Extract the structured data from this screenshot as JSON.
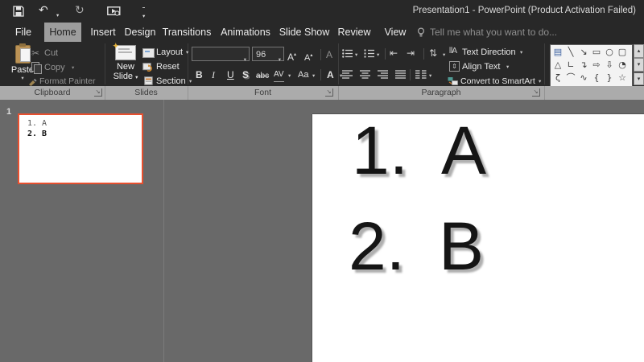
{
  "titlebar": {
    "title": "Presentation1 - PowerPoint (Product Activation Failed)"
  },
  "tabs": [
    {
      "label": "File"
    },
    {
      "label": "Home"
    },
    {
      "label": "Insert"
    },
    {
      "label": "Design"
    },
    {
      "label": "Transitions"
    },
    {
      "label": "Animations"
    },
    {
      "label": "Slide Show"
    },
    {
      "label": "Review"
    },
    {
      "label": "View"
    }
  ],
  "active_tab": "Home",
  "tellme": {
    "text": "Tell me what you want to do..."
  },
  "ribbon": {
    "clipboard": {
      "group_label": "Clipboard",
      "paste": "Paste",
      "cut": "Cut",
      "copy": "Copy",
      "format_painter": "Format Painter"
    },
    "slides": {
      "group_label": "Slides",
      "new_slide_line1": "New",
      "new_slide_line2": "Slide",
      "layout": "Layout",
      "reset": "Reset",
      "section": "Section"
    },
    "font": {
      "group_label": "Font",
      "font_name_value": "",
      "font_size_value": "96",
      "grow_font": "A",
      "shrink_font": "A",
      "clear_formatting": "A",
      "bold": "B",
      "italic": "I",
      "underline": "U",
      "text_shadow": "S",
      "strikethrough": "abc",
      "character_spacing": "AV",
      "change_case": "Aa",
      "font_color": "A"
    },
    "paragraph": {
      "group_label": "Paragraph",
      "text_direction": "Text Direction",
      "align_text": "Align Text",
      "convert_smartart": "Convert to SmartArt"
    },
    "drawing": {
      "shapes": [
        {
          "name": "text-box",
          "glyph": "▤"
        },
        {
          "name": "line",
          "glyph": "╲"
        },
        {
          "name": "line-arrow",
          "glyph": "↘"
        },
        {
          "name": "rectangle",
          "glyph": "▭"
        },
        {
          "name": "oval",
          "glyph": "○"
        },
        {
          "name": "rounded-rectangle",
          "glyph": "▢"
        },
        {
          "name": "triangle",
          "glyph": "△"
        },
        {
          "name": "elbow-connector",
          "glyph": "∟"
        },
        {
          "name": "elbow-arrow-connector",
          "glyph": "↴"
        },
        {
          "name": "right-arrow",
          "glyph": "⇨"
        },
        {
          "name": "down-arrow",
          "glyph": "⇩"
        },
        {
          "name": "pie",
          "glyph": "◔"
        },
        {
          "name": "scribble",
          "glyph": "ζ"
        },
        {
          "name": "arc",
          "glyph": "⌒"
        },
        {
          "name": "curve",
          "glyph": "∿"
        },
        {
          "name": "left-brace",
          "glyph": "{"
        },
        {
          "name": "right-brace",
          "glyph": "}"
        },
        {
          "name": "star",
          "glyph": "☆"
        }
      ]
    }
  },
  "slides_panel": {
    "slide_number": "1",
    "thumbnail_line1": "1. A",
    "thumbnail_line2": "2. B"
  },
  "slide": {
    "lines": [
      {
        "number": "1.",
        "letter": "A"
      },
      {
        "number": "2.",
        "letter": "B"
      }
    ]
  },
  "colors": {
    "selected_slide_border": "#E8502F",
    "active_tab_background": "#9D9D9D",
    "ribbon_background": "#282828",
    "workspace_background": "#696969"
  }
}
